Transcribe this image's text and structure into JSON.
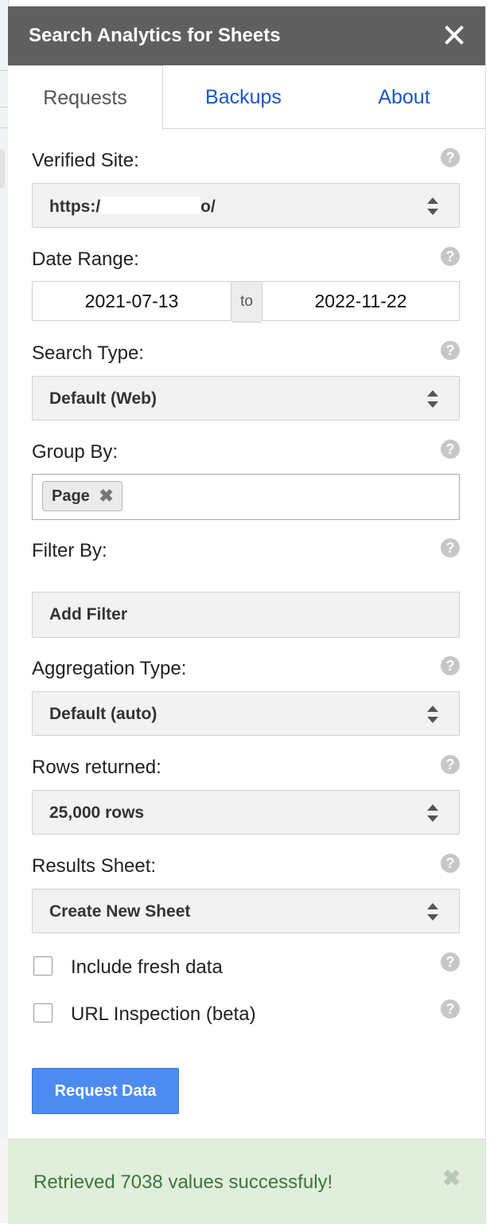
{
  "panel": {
    "title": "Search Analytics for Sheets"
  },
  "tabs": [
    {
      "label": "Requests"
    },
    {
      "label": "Backups"
    },
    {
      "label": "About"
    }
  ],
  "help_icon": "?",
  "form": {
    "verified_site": {
      "label": "Verified Site:",
      "value_prefix": "https:/",
      "value_suffix": "o/"
    },
    "date_range": {
      "label": "Date Range:",
      "from": "2021-07-13",
      "separator": "to",
      "to": "2022-11-22"
    },
    "search_type": {
      "label": "Search Type:",
      "value": "Default (Web)"
    },
    "group_by": {
      "label": "Group By:",
      "chip": "Page",
      "chip_remove": "✖"
    },
    "filter_by": {
      "label": "Filter By:",
      "button": "Add Filter"
    },
    "aggregation_type": {
      "label": "Aggregation Type:",
      "value": "Default (auto)"
    },
    "rows_returned": {
      "label": "Rows returned:",
      "value": "25,000 rows"
    },
    "results_sheet": {
      "label": "Results Sheet:",
      "value": "Create New Sheet"
    },
    "include_fresh_data": {
      "label": "Include fresh data",
      "checked": false
    },
    "url_inspection": {
      "label": "URL Inspection (beta)",
      "checked": false
    },
    "submit": "Request Data"
  },
  "status": {
    "message": "Retrieved 7038 values successfuly!",
    "close": "✖"
  },
  "colors": {
    "header": "#5f5f5f",
    "link": "#1a57c7",
    "primary": "#4d8bf0",
    "success_bg": "#e1eedc",
    "success_text": "#3c763d"
  },
  "icons": {
    "close": "close-icon",
    "help": "help-icon",
    "select_arrows": "sort-arrows-icon",
    "chip_remove": "remove-icon"
  }
}
